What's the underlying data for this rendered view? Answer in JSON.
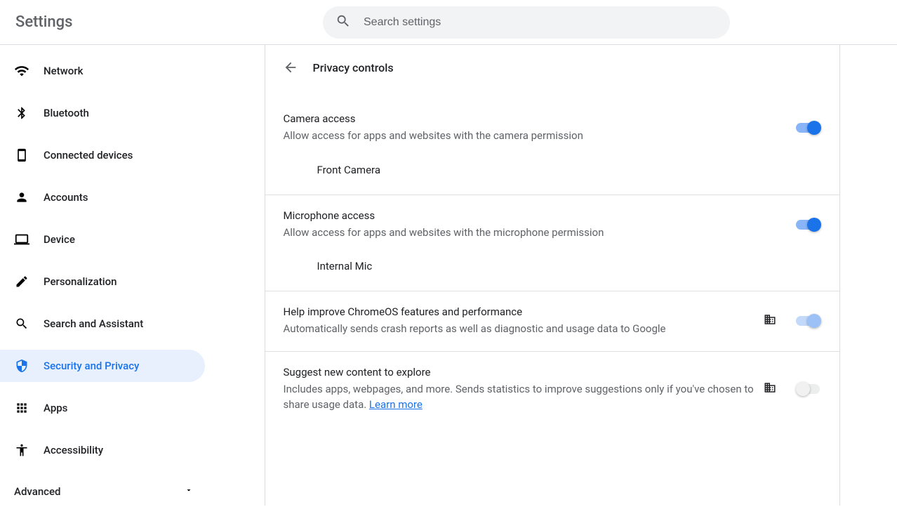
{
  "header": {
    "title": "Settings",
    "search_placeholder": "Search settings"
  },
  "sidebar": {
    "items": [
      {
        "id": "network",
        "label": "Network"
      },
      {
        "id": "bluetooth",
        "label": "Bluetooth"
      },
      {
        "id": "connected-devices",
        "label": "Connected devices"
      },
      {
        "id": "accounts",
        "label": "Accounts"
      },
      {
        "id": "device",
        "label": "Device"
      },
      {
        "id": "personalization",
        "label": "Personalization"
      },
      {
        "id": "search-and-assistant",
        "label": "Search and Assistant"
      },
      {
        "id": "security-and-privacy",
        "label": "Security and Privacy"
      },
      {
        "id": "apps",
        "label": "Apps"
      },
      {
        "id": "accessibility",
        "label": "Accessibility"
      }
    ],
    "advanced_label": "Advanced"
  },
  "page": {
    "title": "Privacy controls"
  },
  "settings": {
    "camera": {
      "title": "Camera access",
      "desc": "Allow access for apps and websites with the camera permission",
      "sub": "Front Camera",
      "on": true
    },
    "mic": {
      "title": "Microphone access",
      "desc": "Allow access for apps and websites with the microphone permission",
      "sub": "Internal Mic",
      "on": true
    },
    "improve": {
      "title": "Help improve ChromeOS features and performance",
      "desc": "Automatically sends crash reports as well as diagnostic and usage data to Google",
      "on": true,
      "managed": true,
      "disabled": true
    },
    "suggest": {
      "title": "Suggest new content to explore",
      "desc_prefix": "Includes apps, webpages, and more. Sends statistics to improve suggestions only if you've chosen to share usage data. ",
      "learn_more": "Learn more",
      "on": false,
      "managed": true,
      "disabled": true
    }
  }
}
